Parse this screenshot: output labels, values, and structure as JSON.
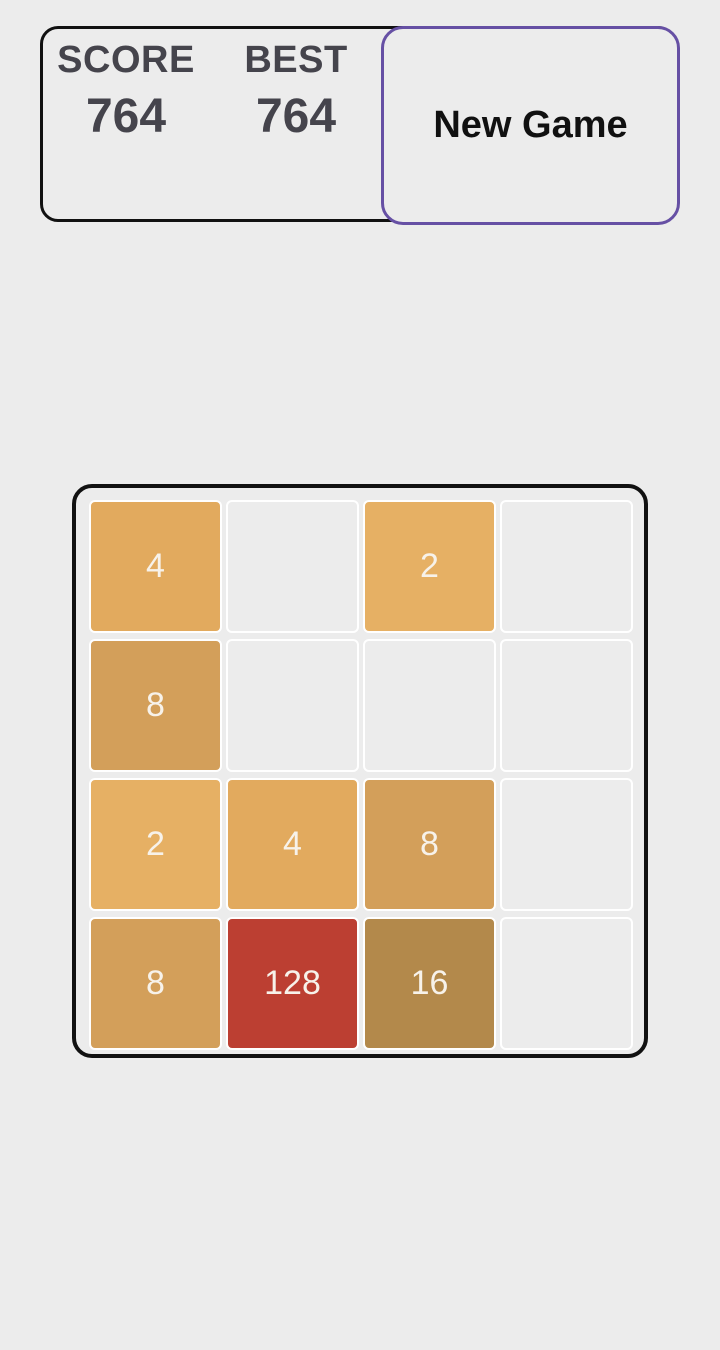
{
  "header": {
    "score_label": "SCORE",
    "score_value": "764",
    "best_label": "BEST",
    "best_value": "764"
  },
  "actions": {
    "new_game_label": "New Game"
  },
  "colors": {
    "background": "#ececec",
    "button_border": "#6650a4",
    "tile_2": "#e6b064",
    "tile_4": "#e2aa5e",
    "tile_8": "#d39f5a",
    "tile_16": "#b3894b",
    "tile_128": "#bc3f32"
  },
  "board": {
    "rows": [
      [
        "4",
        "",
        "2",
        ""
      ],
      [
        "8",
        "",
        "",
        ""
      ],
      [
        "2",
        "4",
        "8",
        ""
      ],
      [
        "8",
        "128",
        "16",
        ""
      ]
    ]
  }
}
